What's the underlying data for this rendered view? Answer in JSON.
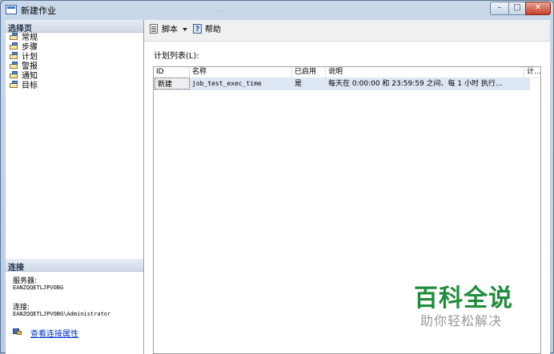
{
  "window": {
    "title": "新建作业",
    "ghost_title": "...",
    "controls": {
      "minimize": "–",
      "maximize": "□",
      "close": "✕"
    }
  },
  "left_pane": {
    "select_header": "选择页",
    "nav_items": [
      "常规",
      "步骤",
      "计划",
      "警报",
      "通知",
      "目标"
    ],
    "connection_header": "连接",
    "server_label": "服务器:",
    "server_value": "EANZQQETLJPVOBG",
    "connection_label": "连接:",
    "connection_value": "EANZQQETLJPVOBG\\Administrator",
    "view_link": "查看连接属性"
  },
  "toolbar": {
    "script_label": "脚本",
    "help_label": "帮助"
  },
  "schedule": {
    "list_label": "计划列表(L):",
    "columns": [
      "ID",
      "名称",
      "已启用",
      "说明",
      "计..."
    ],
    "rows": [
      {
        "id": "新建",
        "name": "job_test_exec_time",
        "enabled": "是",
        "description": "每天在 0:00:00 和 23:59:59 之间、每 1 小时 执行..."
      }
    ]
  },
  "watermark": {
    "brand": "百科全说",
    "slogan": "助你轻松解决"
  }
}
